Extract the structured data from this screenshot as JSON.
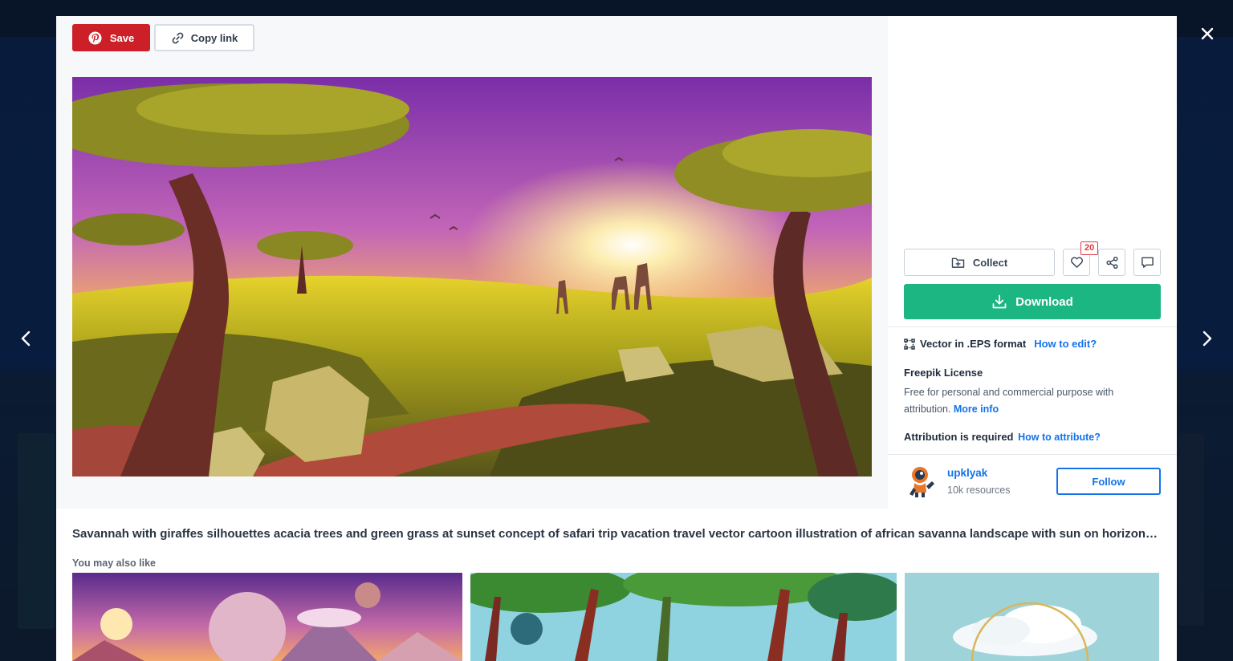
{
  "toolbar": {
    "save_label": "Save",
    "copy_link_label": "Copy link"
  },
  "actions": {
    "collect_label": "Collect",
    "like_count": "20",
    "download_label": "Download"
  },
  "file_info": {
    "format_text": "Vector in .EPS format",
    "how_to_edit_link": "How to edit?"
  },
  "license": {
    "title": "Freepik License",
    "description": "Free for personal and commercial purpose with attribution.",
    "more_info_link": "More info",
    "attribution_text": "Attribution is required",
    "attribution_link": "How to attribute?"
  },
  "author": {
    "name": "upklyak",
    "resources": "10k resources",
    "follow_label": "Follow"
  },
  "resource": {
    "title": "Savannah with giraffes silhouettes acacia trees and green grass at sunset concept of safari trip vacation travel vector cartoon illustration of african savanna landscape with sun on horizon F..."
  },
  "related": {
    "heading": "You may also like"
  },
  "colors": {
    "save_red": "#cc1f27",
    "download_green": "#1bb682",
    "link_blue": "#1273eb"
  },
  "icons": {
    "save": "pinterest-icon",
    "copy": "link-icon",
    "collect": "folder-plus-icon",
    "like": "heart-icon",
    "share": "share-icon",
    "comment": "comment-icon",
    "download": "download-icon",
    "format": "vector-icon",
    "close": "close-icon",
    "prev": "chevron-left-icon",
    "next": "chevron-right-icon"
  }
}
